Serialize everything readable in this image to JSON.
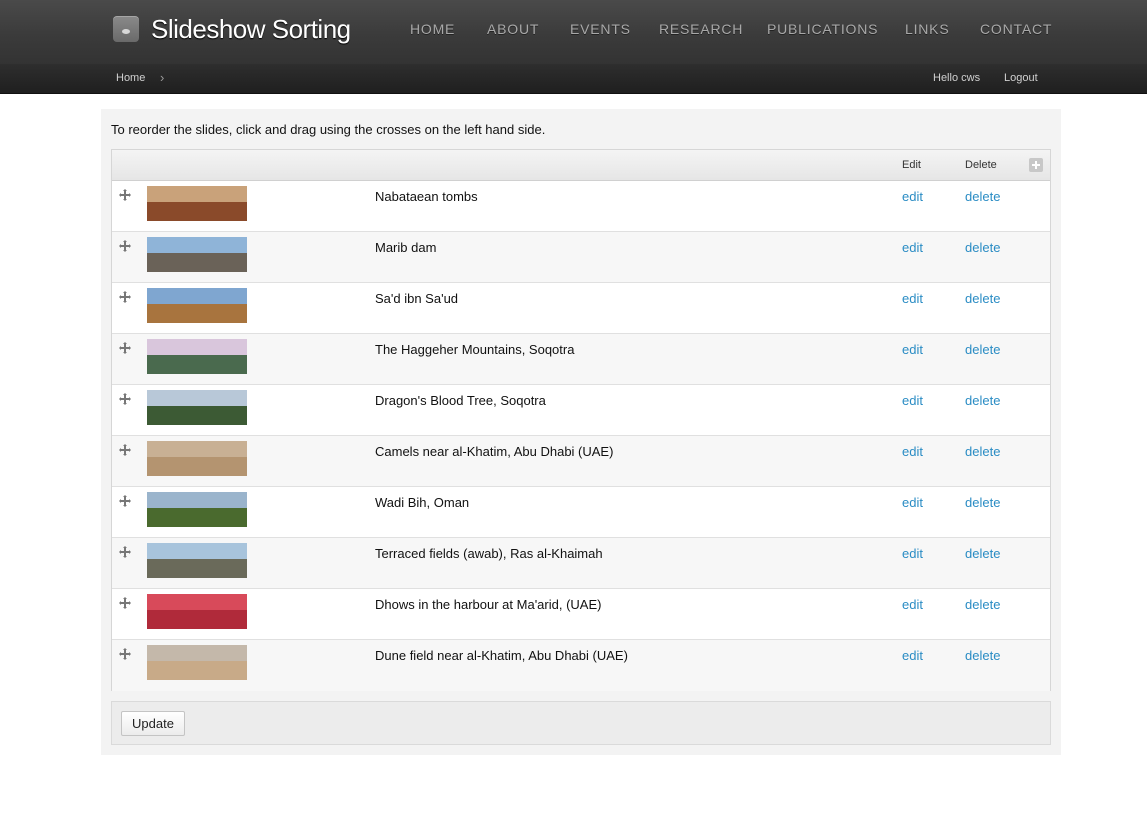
{
  "site": {
    "name": "Slideshow Sorting"
  },
  "nav": [
    {
      "label": "HOME"
    },
    {
      "label": "ABOUT"
    },
    {
      "label": "EVENTS"
    },
    {
      "label": "RESEARCH"
    },
    {
      "label": "PUBLICATIONS"
    },
    {
      "label": "LINKS"
    },
    {
      "label": "CONTACT"
    }
  ],
  "breadcrumb": {
    "home": "Home",
    "separator": "›"
  },
  "user": {
    "greeting": "Hello cws",
    "logout": "Logout"
  },
  "main": {
    "instructions": "To reorder the slides, click and drag using the crosses on the left hand side.",
    "columns": {
      "edit": "Edit",
      "delete": "Delete"
    },
    "rows": [
      {
        "title": "Nabataean tombs",
        "edit": "edit",
        "delete": "delete",
        "thumb": {
          "sky": "#c9a27a",
          "land": "#8a4a2a"
        }
      },
      {
        "title": "Marib dam",
        "edit": "edit",
        "delete": "delete",
        "thumb": {
          "sky": "#8fb4d8",
          "land": "#6a6258"
        }
      },
      {
        "title": "Sa'd ibn Sa'ud",
        "edit": "edit",
        "delete": "delete",
        "thumb": {
          "sky": "#7fa6d0",
          "land": "#a8743e"
        }
      },
      {
        "title": "The Haggeher Mountains, Soqotra",
        "edit": "edit",
        "delete": "delete",
        "thumb": {
          "sky": "#d9c6dc",
          "land": "#4a6a4e"
        }
      },
      {
        "title": "Dragon's Blood Tree, Soqotra",
        "edit": "edit",
        "delete": "delete",
        "thumb": {
          "sky": "#b8c8d8",
          "land": "#3c5a34"
        }
      },
      {
        "title": "Camels near al-Khatim, Abu Dhabi (UAE)",
        "edit": "edit",
        "delete": "delete",
        "thumb": {
          "sky": "#c8b094",
          "land": "#b49470"
        }
      },
      {
        "title": "Wadi Bih, Oman",
        "edit": "edit",
        "delete": "delete",
        "thumb": {
          "sky": "#9ab4cc",
          "land": "#4a6a2e"
        }
      },
      {
        "title": "Terraced fields (awab), Ras al-Khaimah",
        "edit": "edit",
        "delete": "delete",
        "thumb": {
          "sky": "#a8c4dc",
          "land": "#6a6a5a"
        }
      },
      {
        "title": "Dhows in the harbour at Ma'arid, (UAE)",
        "edit": "edit",
        "delete": "delete",
        "thumb": {
          "sky": "#d84a5a",
          "land": "#b02a3a"
        }
      },
      {
        "title": "Dune field near al-Khatim, Abu Dhabi (UAE)",
        "edit": "edit",
        "delete": "delete",
        "thumb": {
          "sky": "#c4b8aa",
          "land": "#c8aa88"
        }
      }
    ],
    "update_label": "Update"
  },
  "colors": {
    "link": "#2a8cc4",
    "header": "#3b3b3b",
    "panel": "#f3f3f3"
  }
}
